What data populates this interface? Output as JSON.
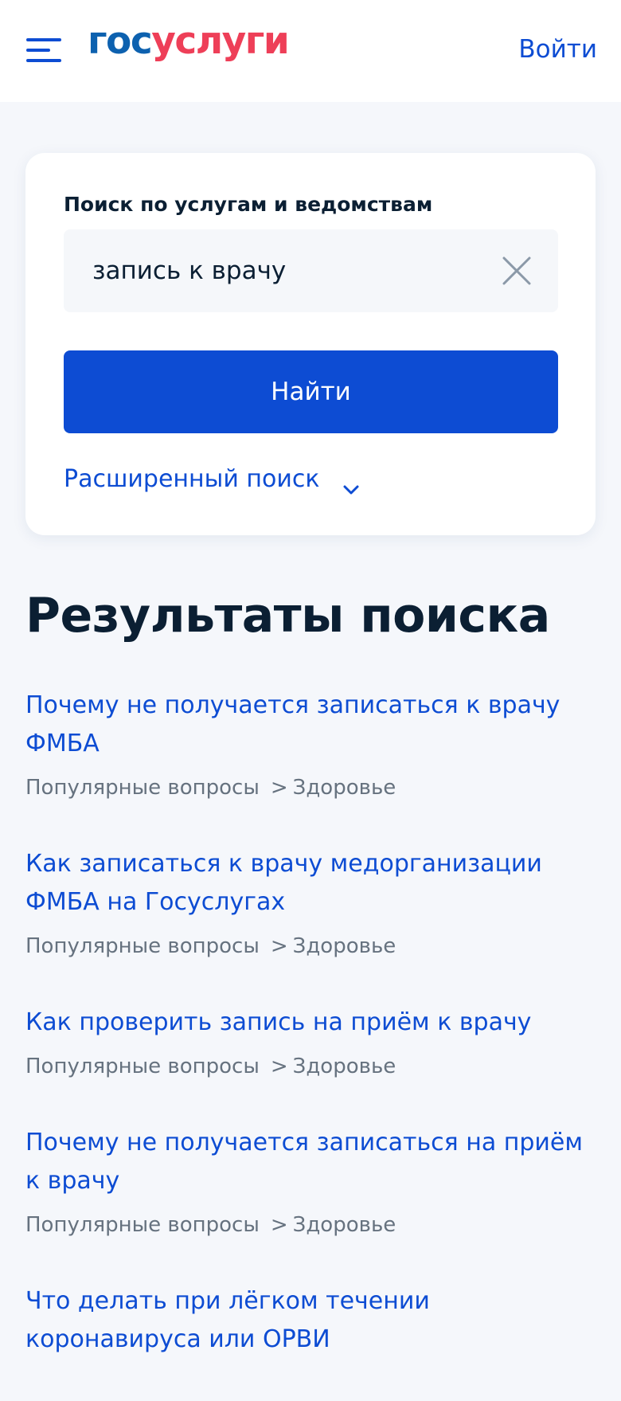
{
  "header": {
    "logo_part1": "гос",
    "logo_part2": "услуги",
    "login_label": "Войти"
  },
  "search": {
    "label": "Поиск по услугам и ведомствам",
    "value": "запись к врачу",
    "find_button": "Найти",
    "advanced_label": "Расширенный поиск"
  },
  "results": {
    "title": "Результаты поиска",
    "items": [
      {
        "title": "Почему не получается записаться к врачу ФМБА",
        "category": "Популярные вопросы",
        "separator": ">",
        "subcategory": "Здоровье"
      },
      {
        "title": "Как записаться к врачу медорганизации ФМБА на Госуслугах",
        "category": "Популярные вопросы",
        "separator": ">",
        "subcategory": "Здоровье"
      },
      {
        "title": "Как проверить запись на приём к врачу",
        "category": "Популярные вопросы",
        "separator": ">",
        "subcategory": "Здоровье"
      },
      {
        "title": "Почему не получается записаться на приём к врачу",
        "category": "Популярные вопросы",
        "separator": ">",
        "subcategory": "Здоровье"
      },
      {
        "title": "Что делать при лёгком течении коронавируса или ОРВИ",
        "category": "",
        "separator": "",
        "subcategory": ""
      }
    ]
  },
  "colors": {
    "accent": "#0d4cd3",
    "logo_blue": "#0d61af",
    "logo_red": "#ee3f58",
    "background": "#f5f7fb",
    "text_dark": "#0b1f33",
    "text_muted": "#66727f"
  },
  "icons": {
    "menu": "menu-icon",
    "clear": "close-icon",
    "advanced": "chevron-down-icon"
  }
}
